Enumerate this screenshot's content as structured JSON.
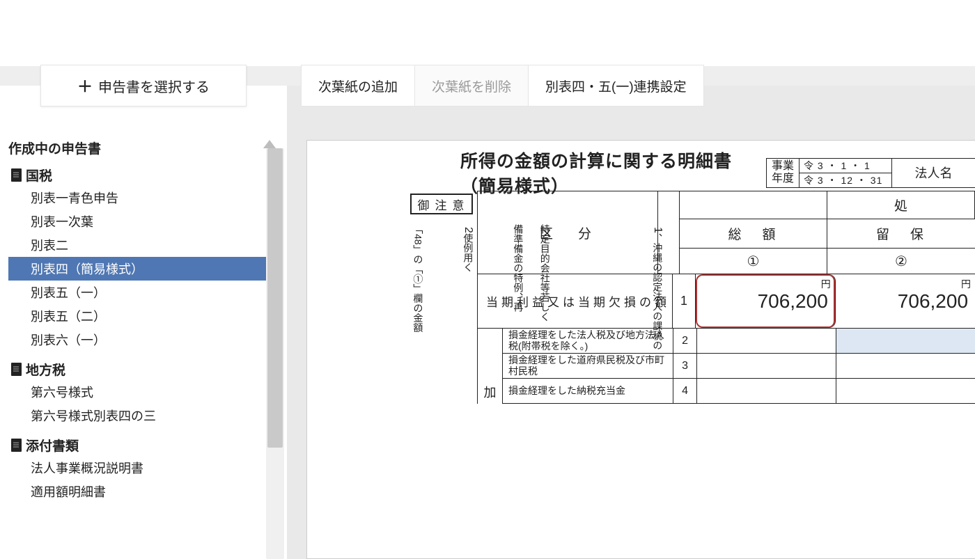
{
  "topbar": {
    "select_doc": "申告書を選択する"
  },
  "tabs": {
    "add_sheet": "次葉紙の追加",
    "delete_sheet": "次葉紙を削除",
    "link_setting": "別表四・五(一)連携設定"
  },
  "sidebar": {
    "heading": "作成中の申告書",
    "group_national": "国税",
    "national_items": [
      "別表一青色申告",
      "別表一次葉",
      "別表二",
      "別表四（簡易様式）",
      "別表五（一）",
      "別表五（二）",
      "別表六（一）"
    ],
    "selected_national_idx": 3,
    "group_local": "地方税",
    "local_items": [
      "第六号様式",
      "第六号様式別表四の三"
    ],
    "group_attach": "添付書類",
    "attach_items": [
      "法人事業概況説明書",
      "適用額明細書"
    ]
  },
  "form": {
    "title": "所得の金額の計算に関する明細書（簡易様式）",
    "fy_label": "事業\n年度",
    "fy_from": "令 3 ・ 1 ・ 1",
    "fy_to": "令 3 ・ 12 ・ 31",
    "corp_label": "法人名",
    "notice": "御注意",
    "vnote_1_num": "1",
    "vnote_1": "、沖縄の認定法人の課税の",
    "vnote_2": "特定目的会社等若しく",
    "vnote_3": "備準備金の特例、再",
    "vnote_2_num": "2",
    "vnote_4": "使例用く",
    "vnote_5": "「48」の「①」欄の金額",
    "hdr_kubun": "区分",
    "hdr_total": "総額",
    "hdr_sho": "処",
    "hdr_ryuho": "留保",
    "hdr_col1": "①",
    "hdr_col2": "②",
    "row1_label": "当期利益又は当期欠損の額",
    "row1_num": "1",
    "row1_yen": "円",
    "row1_amount1": "706,200",
    "row1_amount2": "706,200",
    "ka": "加",
    "sub2_label": "損金経理をした法人税及び地方法人税(附帯税を除く。)",
    "sub2_num": "2",
    "sub3_label": "損金経理をした道府県民税及び市町村民税",
    "sub3_num": "3",
    "sub4_label": "損金経理をした納税充当金",
    "sub4_num": "4"
  }
}
